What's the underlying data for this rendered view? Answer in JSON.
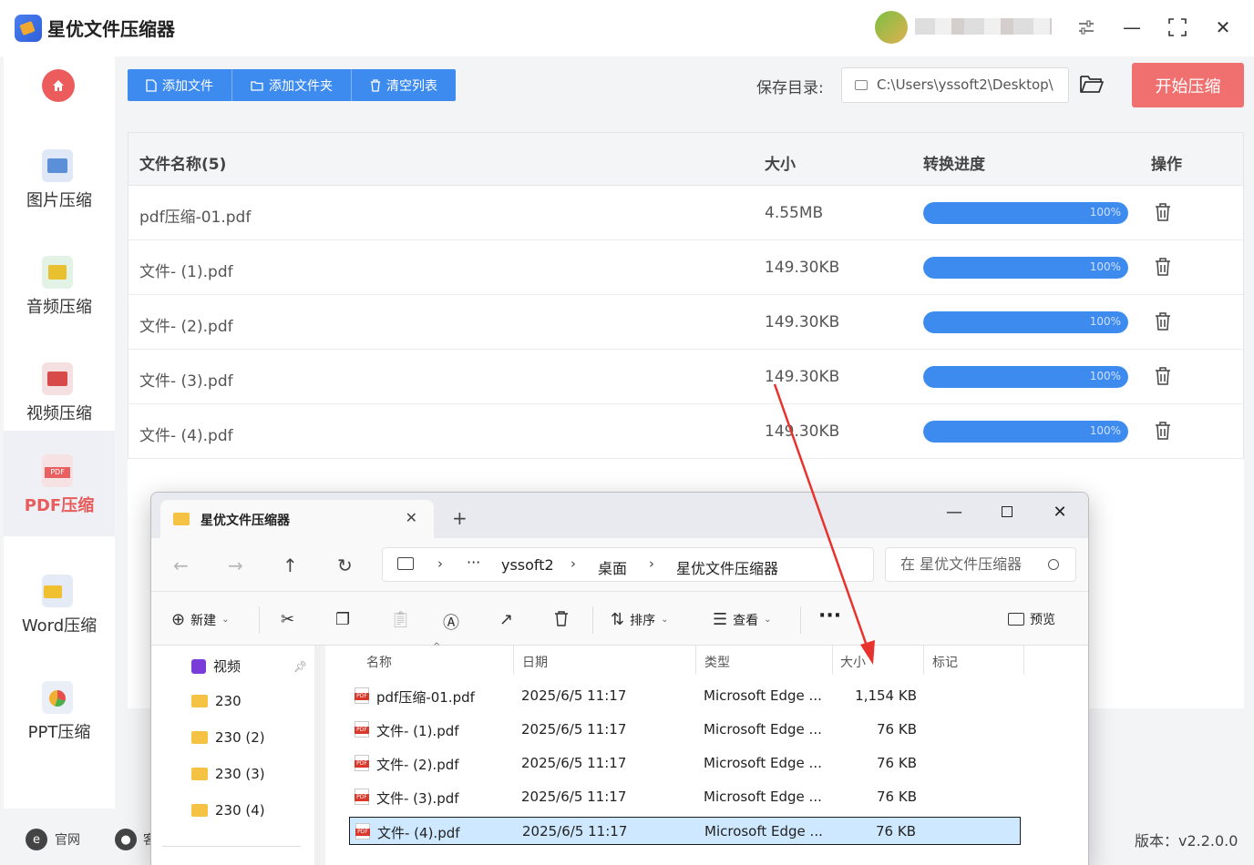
{
  "app": {
    "title": "星优文件压缩器"
  },
  "sidebar": {
    "items": [
      {
        "label": "图片压缩",
        "color": "#5b8fd8"
      },
      {
        "label": "音频压缩",
        "color": "#5bb870"
      },
      {
        "label": "视频压缩",
        "color": "#e05a5a"
      },
      {
        "label": "PDF压缩",
        "color": "#e86060",
        "active": true
      },
      {
        "label": "Word压缩",
        "color": "#f0c030"
      },
      {
        "label": "PPT压缩",
        "color": "#e8a040"
      }
    ]
  },
  "toolbar": {
    "add_file": "添加文件",
    "add_folder": "添加文件夹",
    "clear_list": "清空列表"
  },
  "save": {
    "label": "保存目录:",
    "path": "C:\\Users\\yssoft2\\Desktop\\"
  },
  "start_button": "开始压缩",
  "table": {
    "headers": {
      "name": "文件名称(5)",
      "size": "大小",
      "progress": "转换进度",
      "action": "操作"
    },
    "rows": [
      {
        "name": "pdf压缩-01.pdf",
        "size": "4.55MB",
        "progress": 100,
        "progress_text": "100%"
      },
      {
        "name": "文件- (1).pdf",
        "size": "149.30KB",
        "progress": 100,
        "progress_text": "100%"
      },
      {
        "name": "文件- (2).pdf",
        "size": "149.30KB",
        "progress": 100,
        "progress_text": "100%"
      },
      {
        "name": "文件- (3).pdf",
        "size": "149.30KB",
        "progress": 100,
        "progress_text": "100%"
      },
      {
        "name": "文件- (4).pdf",
        "size": "149.30KB",
        "progress": 100,
        "progress_text": "100%"
      }
    ]
  },
  "footer": {
    "website": "官网",
    "service": "客",
    "version": "版本：v2.2.0.0"
  },
  "explorer": {
    "tab_title": "星优文件压缩器",
    "breadcrumbs": [
      "yssoft2",
      "桌面",
      "星优文件压缩器"
    ],
    "search_placeholder": "在 星优文件压缩器",
    "commands": {
      "new": "新建",
      "sort": "排序",
      "view": "查看",
      "preview": "预览"
    },
    "tree": [
      {
        "label": "视频",
        "type": "video",
        "pinned": true
      },
      {
        "label": "230",
        "type": "folder"
      },
      {
        "label": "230 (2)",
        "type": "folder"
      },
      {
        "label": "230 (3)",
        "type": "folder"
      },
      {
        "label": "230 (4)",
        "type": "folder"
      }
    ],
    "columns": {
      "name": "名称",
      "date": "日期",
      "type": "类型",
      "size": "大小",
      "tag": "标记"
    },
    "files": [
      {
        "name": "pdf压缩-01.pdf",
        "date": "2025/6/5 11:17",
        "type": "Microsoft Edge ...",
        "size": "1,154 KB"
      },
      {
        "name": "文件- (1).pdf",
        "date": "2025/6/5 11:17",
        "type": "Microsoft Edge ...",
        "size": "76 KB"
      },
      {
        "name": "文件- (2).pdf",
        "date": "2025/6/5 11:17",
        "type": "Microsoft Edge ...",
        "size": "76 KB"
      },
      {
        "name": "文件- (3).pdf",
        "date": "2025/6/5 11:17",
        "type": "Microsoft Edge ...",
        "size": "76 KB"
      },
      {
        "name": "文件- (4).pdf",
        "date": "2025/6/5 11:17",
        "type": "Microsoft Edge ...",
        "size": "76 KB",
        "selected": true
      }
    ]
  },
  "colors": {
    "accent": "#3e8bef",
    "start": "#f07070",
    "annotation": "#e8322d"
  }
}
